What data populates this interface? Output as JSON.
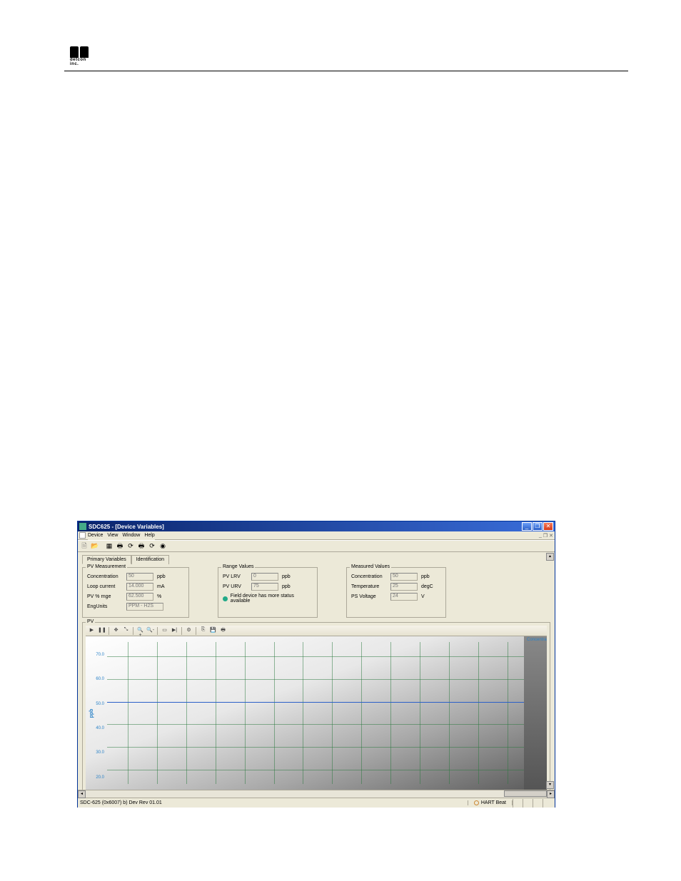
{
  "window": {
    "title": "SDC625 - [Device Variables]",
    "sub_title": "Device Variables"
  },
  "menu": {
    "device": "Device",
    "view": "View",
    "window": "Window",
    "help": "Help"
  },
  "tabs": {
    "primary": "Primary Variables",
    "identification": "Identification"
  },
  "pv_measurement": {
    "legend": "PV Measurement",
    "concentration_label": "Concentration",
    "concentration_value": "50",
    "concentration_unit": "ppb",
    "loop_label": "Loop current",
    "loop_value": "14.000",
    "loop_unit": "mA",
    "pvrange_label": "PV % rnge",
    "pvrange_value": "62.500",
    "pvrange_unit": "%",
    "engunits_label": "EngUnits",
    "engunits_value": "PPM - H2S"
  },
  "range_values": {
    "legend": "Range Values",
    "lrv_label": "PV LRV",
    "lrv_value": "0",
    "lrv_unit": "ppb",
    "urv_label": "PV URV",
    "urv_value": "75",
    "urv_unit": "ppb",
    "status_text": "Field device has more status available"
  },
  "measured_values": {
    "legend": "Measured Values",
    "concentration_label": "Concentration",
    "concentration_value": "50",
    "concentration_unit": "ppb",
    "temperature_label": "Temperature",
    "temperature_value": "25",
    "temperature_unit": "degC",
    "ps_label": "PS Voltage",
    "ps_value": "24",
    "ps_unit": "V"
  },
  "chart": {
    "legend": "PV",
    "y_label": "ppb",
    "legend_item": "Concentra"
  },
  "chart_data": {
    "type": "line",
    "ylabel": "ppb",
    "ylim": [
      15,
      75
    ],
    "y_ticks": [
      20.0,
      30.0,
      40.0,
      50.0,
      60.0,
      70.0
    ],
    "series": [
      {
        "name": "Concentration",
        "value_constant": 50.0
      }
    ]
  },
  "statusbar": {
    "left": "SDC-625   (0x6007) b) Dev Rev 01.01",
    "hart": "HART Beat"
  },
  "logo_text": "detcon inc."
}
